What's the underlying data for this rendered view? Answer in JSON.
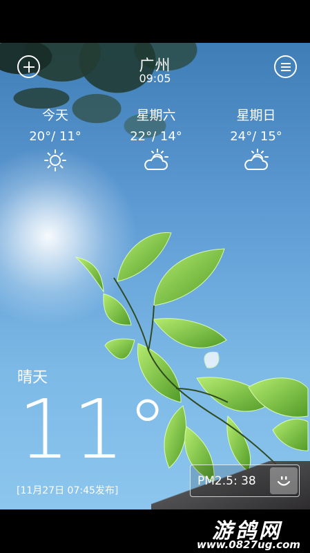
{
  "header": {
    "city": "广州",
    "time": "09:05",
    "add_icon": "plus-icon",
    "menu_icon": "menu-icon"
  },
  "forecast": [
    {
      "day": "今天",
      "range": "20°/ 11°",
      "icon": "sunny-icon"
    },
    {
      "day": "星期六",
      "range": "22°/ 14°",
      "icon": "partly-cloudy-icon"
    },
    {
      "day": "星期日",
      "range": "24°/ 15°",
      "icon": "partly-cloudy-icon"
    }
  ],
  "current": {
    "condition": "晴天",
    "temperature": "11°",
    "published": "[11月27日 07:45发布]"
  },
  "air": {
    "pm25": "PM2.5: 38",
    "face_icon": "smiley-icon"
  },
  "watermark": {
    "title": "游鸽网",
    "url": "www.0827ug.com"
  },
  "colors": {
    "sky_top": "#3f7db7",
    "sky_bottom": "#8cc6ee",
    "leaf": "#7fcf3a",
    "text": "#ffffff"
  }
}
